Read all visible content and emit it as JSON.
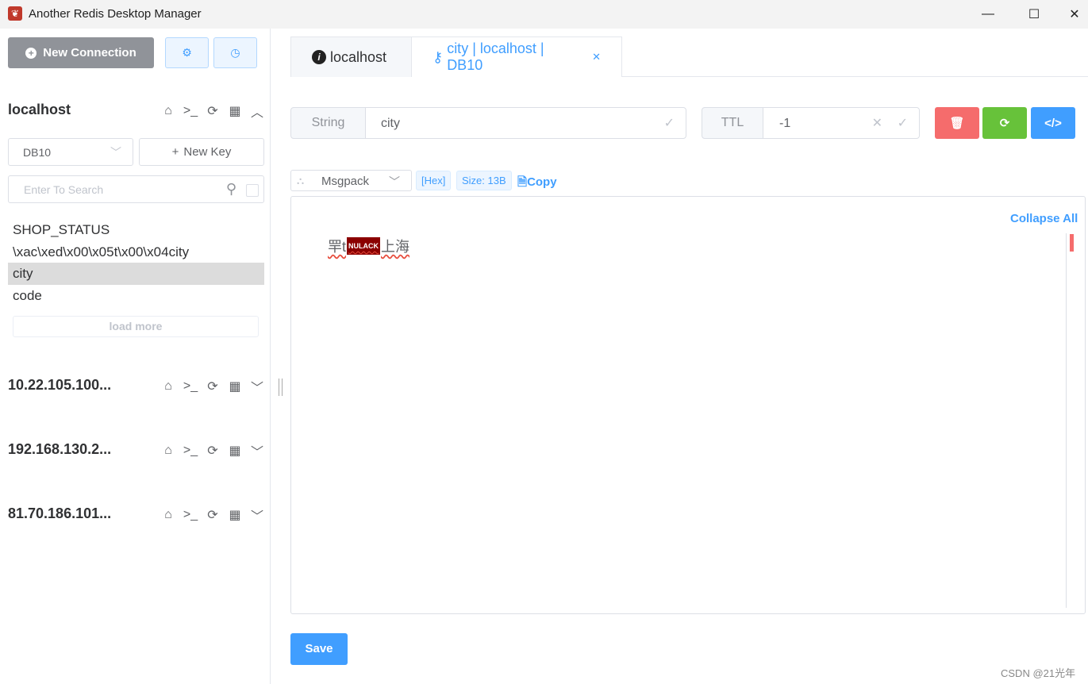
{
  "window": {
    "title": "Another Redis Desktop Manager",
    "minimize_glyph": "—",
    "maximize_glyph": "☐",
    "close_glyph": "✕"
  },
  "sidebar": {
    "new_connection_label": "New Connection",
    "connections": [
      {
        "name": "localhost",
        "expanded": true
      },
      {
        "name": "10.22.105.100...",
        "expanded": false
      },
      {
        "name": "192.168.130.2...",
        "expanded": false
      },
      {
        "name": "81.70.186.101...",
        "expanded": false
      }
    ],
    "db_selected": "DB10",
    "new_key_label": "New Key",
    "search_placeholder": "Enter To Search",
    "keys": [
      "SHOP_STATUS",
      "\\xac\\xed\\x00\\x05t\\x00\\x04city",
      "city",
      "code"
    ],
    "active_key": "city",
    "load_more_label": "load more"
  },
  "tabs": [
    {
      "label": "localhost",
      "icon": "info-icon"
    },
    {
      "label": "city | localhost | DB10",
      "icon": "key-icon",
      "active": true,
      "close_glyph": "✕"
    }
  ],
  "key_detail": {
    "type": "String",
    "name": "city",
    "ttl_label": "TTL",
    "ttl_value": "-1",
    "format": "Msgpack",
    "hex_tag": "[Hex]",
    "size_tag": "Size: 13B",
    "copy_label": "Copy",
    "collapse_label": "Collapse All",
    "value_prefix": "䍐t",
    "value_null": "NULACK",
    "value_suffix": "上海",
    "save_label": "Save"
  },
  "watermark": "CSDN @21光年",
  "colors": {
    "primary": "#409eff",
    "danger": "#f56c6c",
    "success": "#67c23a",
    "gray_button": "#909399"
  }
}
